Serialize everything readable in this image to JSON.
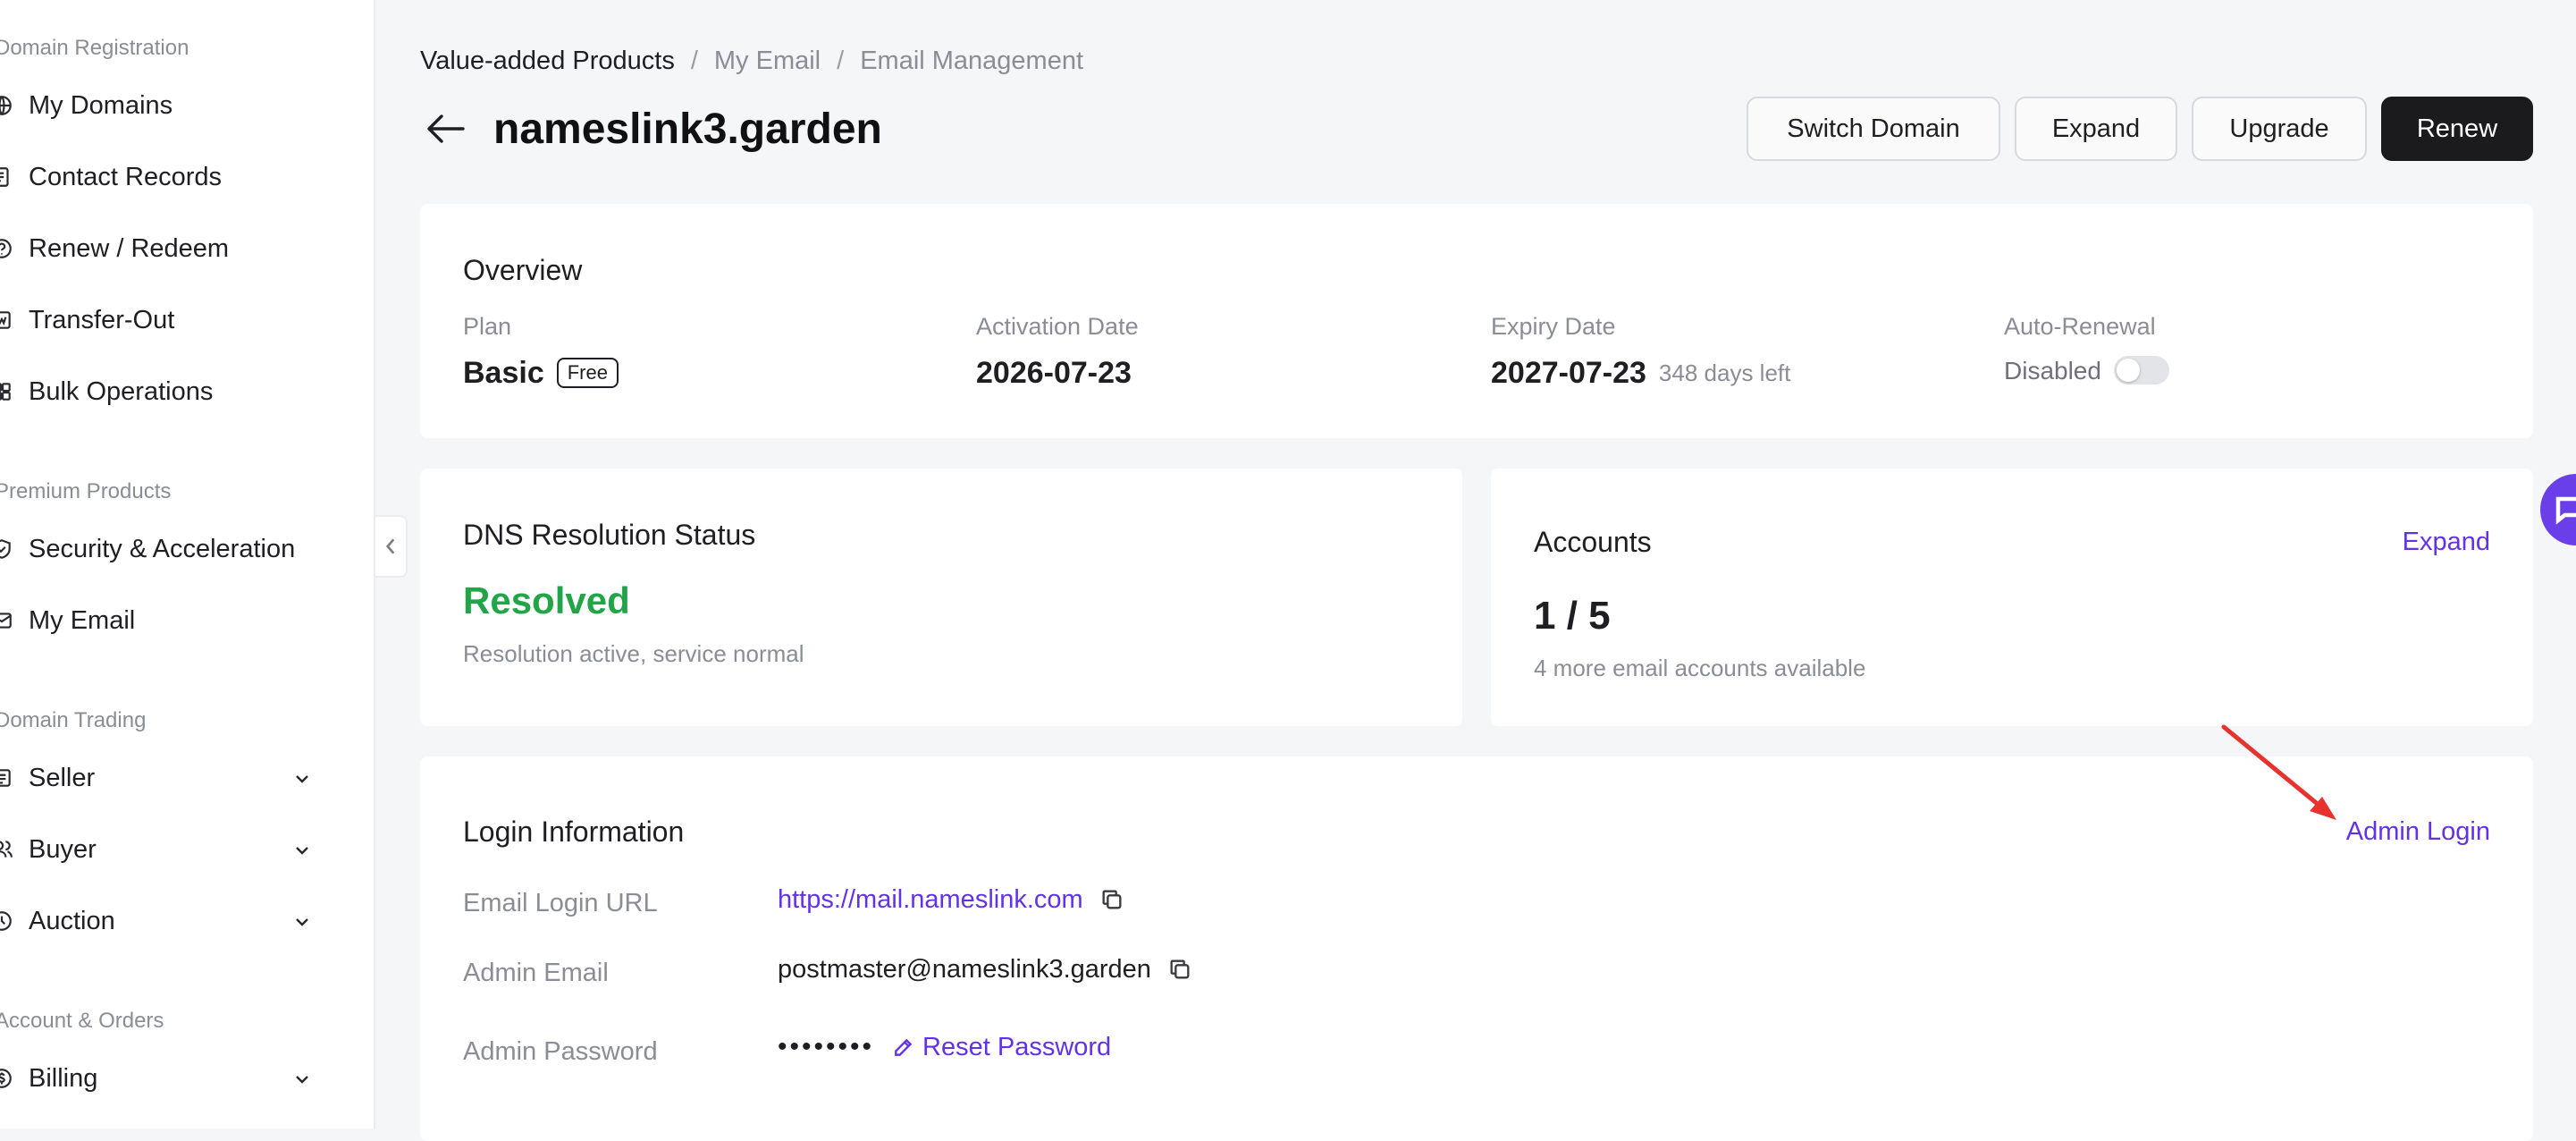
{
  "sidebar": {
    "sections": [
      {
        "title": "Domain Registration"
      },
      {
        "title": "Premium Products"
      },
      {
        "title": "Domain Trading"
      },
      {
        "title": "Account & Orders"
      }
    ],
    "items": [
      {
        "label": "My Domains",
        "icon": "globe-icon"
      },
      {
        "label": "Contact Records",
        "icon": "contact-record-icon"
      },
      {
        "label": "Renew / Redeem",
        "icon": "renew-icon"
      },
      {
        "label": "Transfer-Out",
        "icon": "transfer-out-icon"
      },
      {
        "label": "Bulk Operations",
        "icon": "grid-icon"
      },
      {
        "label": "Security & Acceleration",
        "icon": "shield-icon"
      },
      {
        "label": "My Email",
        "icon": "mail-icon"
      },
      {
        "label": "Seller",
        "icon": "seller-icon"
      },
      {
        "label": "Buyer",
        "icon": "users-icon"
      },
      {
        "label": "Auction",
        "icon": "clock-icon"
      },
      {
        "label": "Billing",
        "icon": "billing-icon"
      }
    ]
  },
  "breadcrumb": {
    "items": [
      "Value-added Products",
      "My Email",
      "Email Management"
    ],
    "separator": "/"
  },
  "header": {
    "title": "nameslink3.garden",
    "buttons": {
      "switch_domain": "Switch Domain",
      "expand": "Expand",
      "upgrade": "Upgrade",
      "renew": "Renew"
    }
  },
  "overview": {
    "title": "Overview",
    "plan_label": "Plan",
    "plan_value": "Basic",
    "plan_badge": "Free",
    "activation_label": "Activation Date",
    "activation_value": "2026-07-23",
    "expiry_label": "Expiry Date",
    "expiry_value": "2027-07-23",
    "days_left": "348 days left",
    "auto_renewal_label": "Auto-Renewal",
    "auto_renewal_value": "Disabled",
    "auto_renewal_enabled": false
  },
  "dns": {
    "title": "DNS Resolution Status",
    "status": "Resolved",
    "description": "Resolution active, service normal",
    "status_color": "#22a548"
  },
  "accounts": {
    "title": "Accounts",
    "expand_label": "Expand",
    "count": "1 / 5",
    "description": "4 more email accounts available"
  },
  "login_info": {
    "title": "Login Information",
    "admin_login_label": "Admin Login",
    "email_login_url_label": "Email Login URL",
    "email_login_url_value": "https://mail.nameslink.com",
    "admin_email_label": "Admin Email",
    "admin_email_value": "postmaster@nameslink3.garden",
    "admin_password_label": "Admin Password",
    "admin_password_value": "••••••••",
    "reset_password_label": "Reset Password"
  },
  "colors": {
    "accent": "#6432e6",
    "primary_button": "#1b1b1d",
    "success": "#22a548",
    "annotation_arrow": "#e8322e"
  }
}
